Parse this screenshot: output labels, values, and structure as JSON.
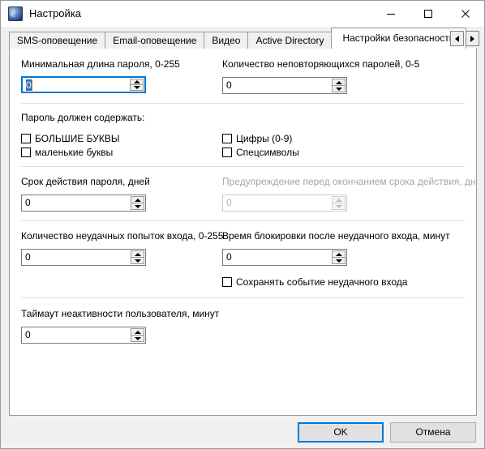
{
  "window": {
    "title": "Настройка",
    "icon": "app-globe-icon",
    "controls": {
      "minimize": "minimize-icon",
      "maximize": "maximize-icon",
      "close": "close-icon"
    }
  },
  "tabs": {
    "items": [
      {
        "label": "SMS-оповещение",
        "active": false
      },
      {
        "label": "Email-оповещение",
        "active": false
      },
      {
        "label": "Видео",
        "active": false
      },
      {
        "label": "Active Directory",
        "active": false
      },
      {
        "label": "Настройки безопасности",
        "active": true
      }
    ],
    "scroll_left": "scroll-left-icon",
    "scroll_right": "scroll-right-icon"
  },
  "form": {
    "min_password_length": {
      "label": "Минимальная длина пароля, 0-255",
      "value": "0",
      "focused": true,
      "disabled": false
    },
    "unique_passwords_count": {
      "label": "Количество неповторяющихся паролей, 0-5",
      "value": "0",
      "focused": false,
      "disabled": false
    },
    "password_must_contain": {
      "caption": "Пароль должен содержать:",
      "options": [
        {
          "label": "БОЛЬШИЕ БУКВЫ",
          "checked": false
        },
        {
          "label": "маленькие буквы",
          "checked": false
        },
        {
          "label": "Цифры (0-9)",
          "checked": false
        },
        {
          "label": "Спецсимволы",
          "checked": false
        }
      ]
    },
    "password_validity_days": {
      "label": "Срок действия пароля, дней",
      "value": "0",
      "focused": false,
      "disabled": false
    },
    "expiry_warning_days": {
      "label": "Предупреждение перед окончанием срока действия, дней",
      "value": "0",
      "focused": false,
      "disabled": true
    },
    "failed_login_attempts": {
      "label": "Количество неудачных попыток входа, 0-255",
      "value": "0",
      "focused": false,
      "disabled": false
    },
    "lockout_minutes": {
      "label": "Время блокировки после неудачного входа, минут",
      "value": "0",
      "focused": false,
      "disabled": false
    },
    "save_failed_login_event": {
      "label": "Сохранять событие неудачного входа",
      "checked": false
    },
    "user_inactivity_timeout": {
      "label": "Таймаут неактивности пользователя, минут",
      "value": "0",
      "focused": false,
      "disabled": false
    }
  },
  "footer": {
    "ok_label": "OK",
    "cancel_label": "Отмена"
  },
  "colors": {
    "accent": "#0078d7",
    "window_bg": "#f0f0f0",
    "page_bg": "#ffffff",
    "border": "#9a9a9a",
    "disabled_text": "#a6a6a6",
    "selection": "#2b6fc4"
  }
}
